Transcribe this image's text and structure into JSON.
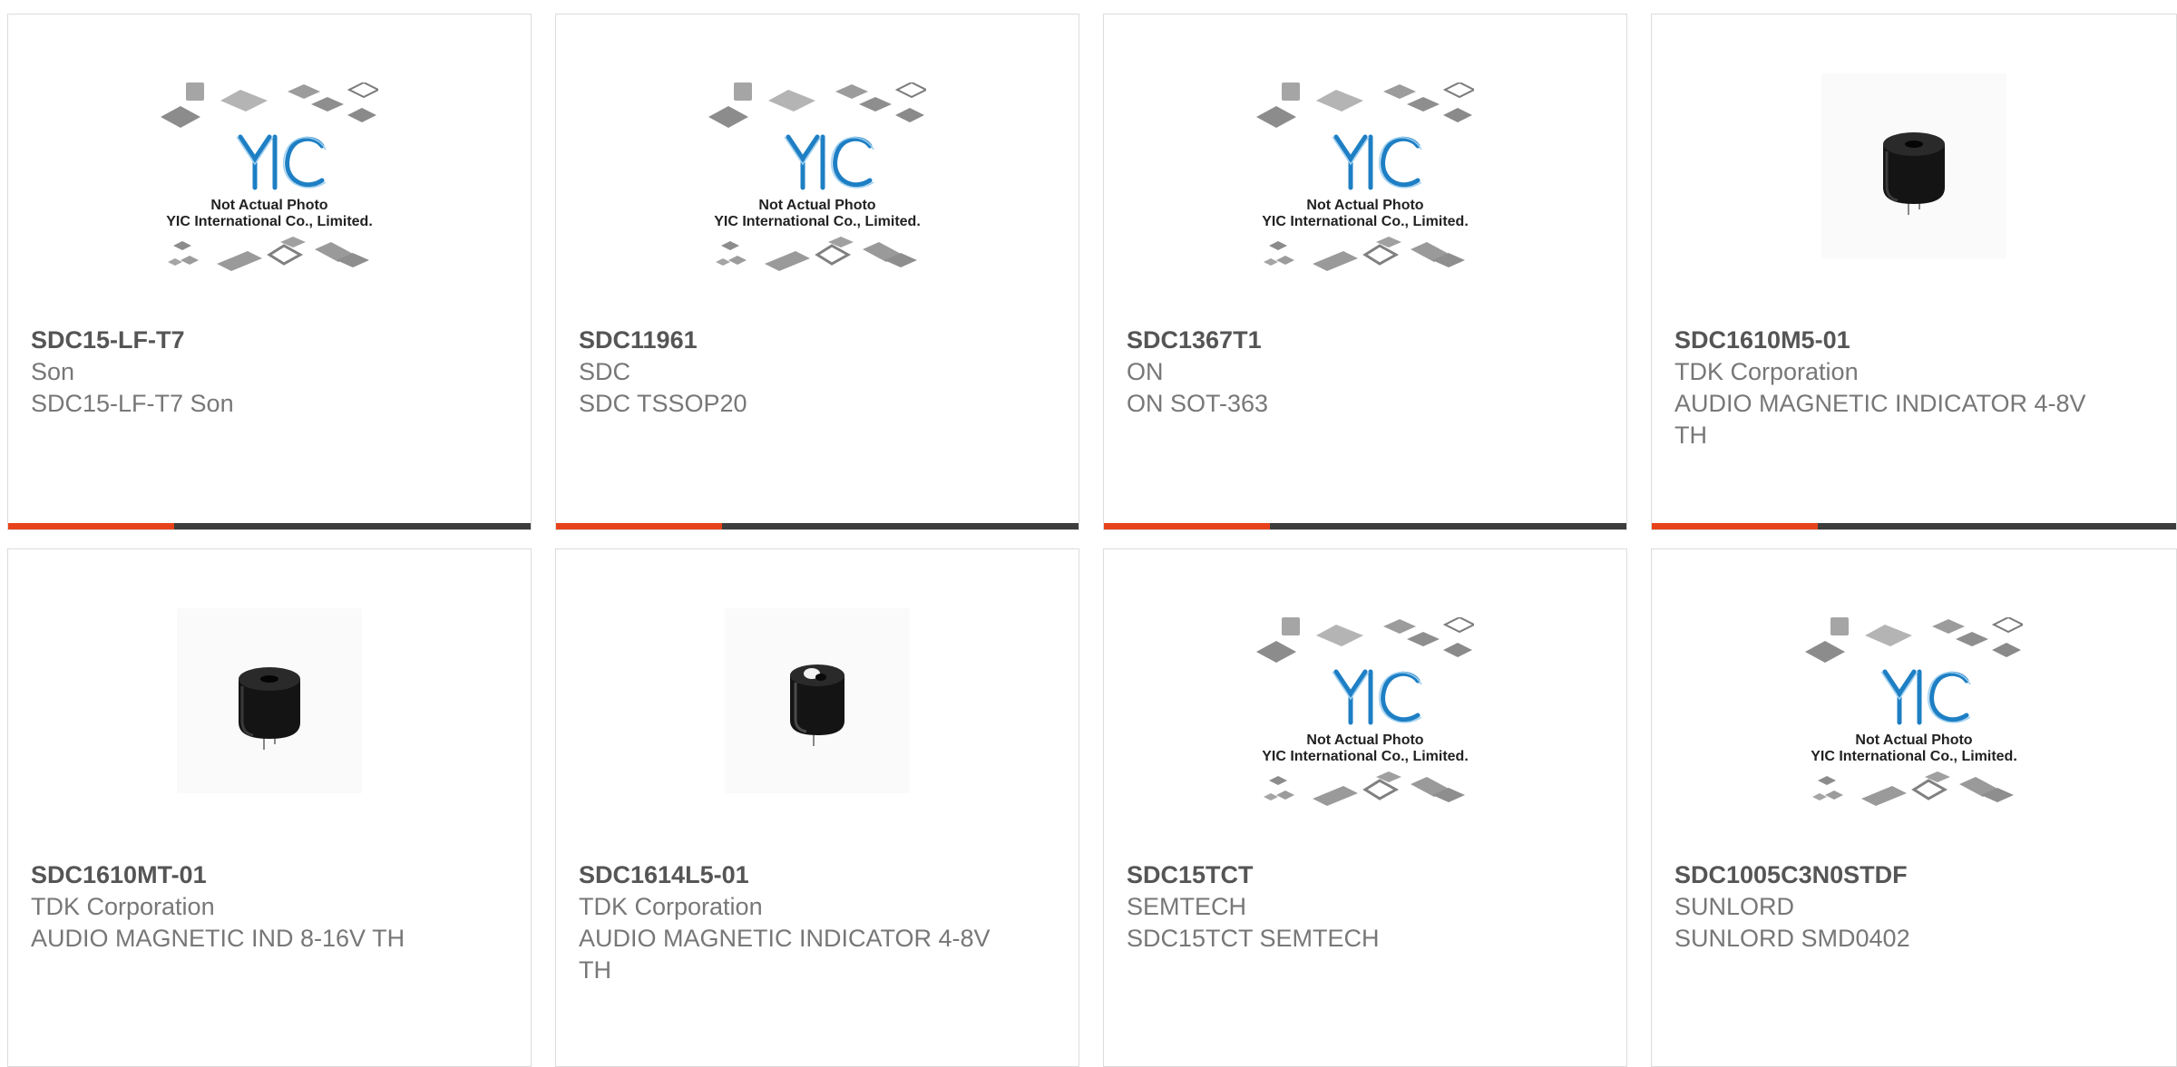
{
  "products": [
    {
      "part": "SDC15-LF-T7",
      "manufacturer": "Son",
      "description": "SDC15-LF-T7 Son",
      "image": "placeholder"
    },
    {
      "part": "SDC11961",
      "manufacturer": "SDC",
      "description": "SDC TSSOP20",
      "image": "placeholder"
    },
    {
      "part": "SDC1367T1",
      "manufacturer": "ON",
      "description": "ON SOT-363",
      "image": "placeholder"
    },
    {
      "part": "SDC1610M5-01",
      "manufacturer": "TDK Corporation",
      "description": "AUDIO MAGNETIC INDICATOR 4-8V TH",
      "image": "buzzer"
    },
    {
      "part": "SDC1610MT-01",
      "manufacturer": "TDK Corporation",
      "description": "AUDIO MAGNETIC IND 8-16V TH",
      "image": "buzzer"
    },
    {
      "part": "SDC1614L5-01",
      "manufacturer": "TDK Corporation",
      "description": "AUDIO MAGNETIC INDICATOR 4-8V TH",
      "image": "buzzer-alt"
    },
    {
      "part": "SDC15TCT",
      "manufacturer": "SEMTECH",
      "description": "SDC15TCT SEMTECH",
      "image": "placeholder"
    },
    {
      "part": "SDC1005C3N0STDF",
      "manufacturer": "SUNLORD",
      "description": "SUNLORD SMD0402",
      "image": "placeholder"
    }
  ],
  "placeholder_image": {
    "logo_text": "YIC",
    "caption_line1": "Not Actual Photo",
    "caption_line2": "YIC International Co., Limited."
  },
  "colors": {
    "accent_bar": "#e8421a",
    "dark_bar": "#3d3d3d",
    "logo_blue": "#1e7fc4"
  }
}
